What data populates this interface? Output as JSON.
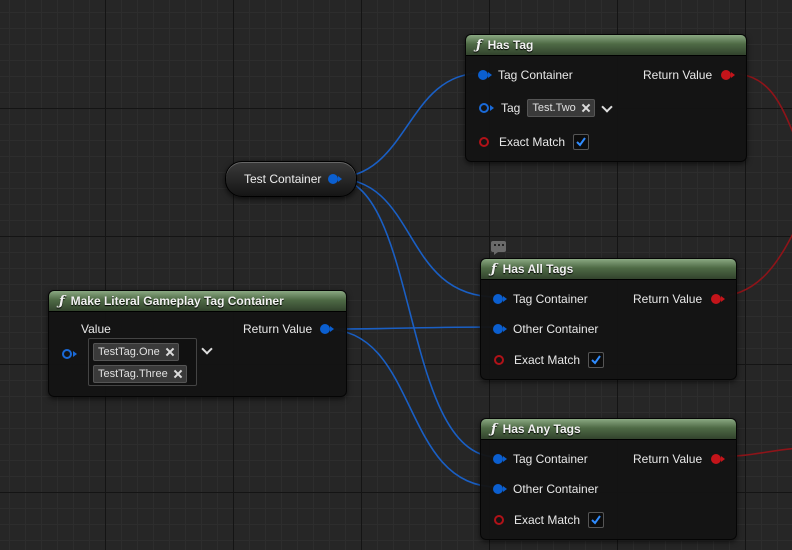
{
  "colors": {
    "exec_blue": "#0b5fd0",
    "bool_red": "#c4141a",
    "header_green": "#4e6a45",
    "wire_red": "#8e1419"
  },
  "variable": {
    "label": "Test Container"
  },
  "make_literal": {
    "title": "Make Literal Gameplay Tag Container",
    "icon": "function-icon",
    "value_label": "Value",
    "return_label": "Return Value",
    "tags": [
      "TestTag.One",
      "TestTag.Three"
    ]
  },
  "has_tag": {
    "title": "Has Tag",
    "icon": "function-icon",
    "tag_container_label": "Tag Container",
    "return_label": "Return Value",
    "tag_label": "Tag",
    "tag_value": "Test.Two",
    "exact_match_label": "Exact Match",
    "exact_match": true
  },
  "has_all_tags": {
    "title": "Has All Tags",
    "icon": "function-icon",
    "tag_container_label": "Tag Container",
    "return_label": "Return Value",
    "other_container_label": "Other Container",
    "exact_match_label": "Exact Match",
    "exact_match": true
  },
  "has_any_tags": {
    "title": "Has Any Tags",
    "icon": "function-icon",
    "tag_container_label": "Tag Container",
    "return_label": "Return Value",
    "other_container_label": "Other Container",
    "exact_match_label": "Exact Match",
    "exact_match": true
  }
}
